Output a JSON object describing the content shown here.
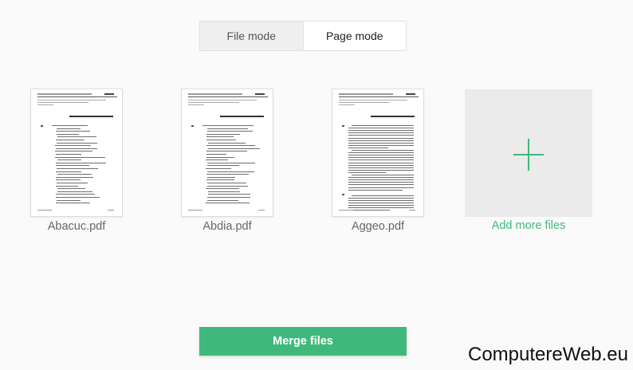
{
  "mode_toggle": {
    "file_mode": "File mode",
    "page_mode": "Page mode"
  },
  "files": [
    {
      "name": "Abacuc.pdf",
      "layout": "list"
    },
    {
      "name": "Abdia.pdf",
      "layout": "list"
    },
    {
      "name": "Aggeo.pdf",
      "layout": "prose"
    }
  ],
  "add_more": {
    "label": "Add more files",
    "icon": "plus-icon"
  },
  "merge_button": {
    "label": "Merge files"
  },
  "watermark": "ComputereWeb.eu",
  "colors": {
    "accent": "#3fb97b",
    "background": "#fafafa",
    "add_box": "#ebebeb"
  }
}
